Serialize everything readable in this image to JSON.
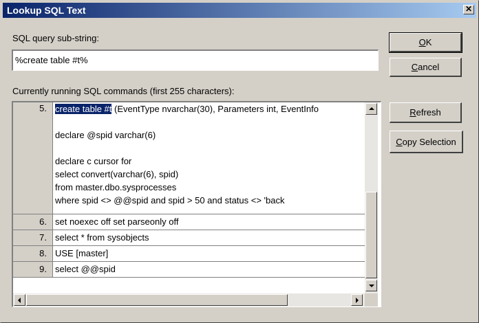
{
  "window": {
    "title": "Lookup SQL Text",
    "close_glyph": "✕"
  },
  "search": {
    "label": "SQL query sub-string:",
    "value": "%create table #t%"
  },
  "results": {
    "label": "Currently running SQL commands (first 255 characters):",
    "rows": [
      {
        "num": "5.",
        "highlight": "create table #t",
        "lines": [
          " (EventType nvarchar(30), Parameters int, EventInfo",
          "",
          "declare @spid varchar(6)",
          "",
          "declare c cursor for",
          "select convert(varchar(6), spid)",
          "from master.dbo.sysprocesses",
          "where spid <> @@spid and spid > 50 and status <> 'back"
        ]
      },
      {
        "num": "6.",
        "text": "set noexec off set parseonly off"
      },
      {
        "num": "7.",
        "text": "select * from sysobjects"
      },
      {
        "num": "8.",
        "text": "USE [master]"
      },
      {
        "num": "9.",
        "text": "select @@spid"
      }
    ]
  },
  "buttons": {
    "ok_prefix": "",
    "ok_u": "O",
    "ok_rest": "K",
    "cancel_u": "C",
    "cancel_rest": "ancel",
    "refresh_u": "R",
    "refresh_rest": "efresh",
    "copy_u": "C",
    "copy_rest": "opy Selection"
  }
}
